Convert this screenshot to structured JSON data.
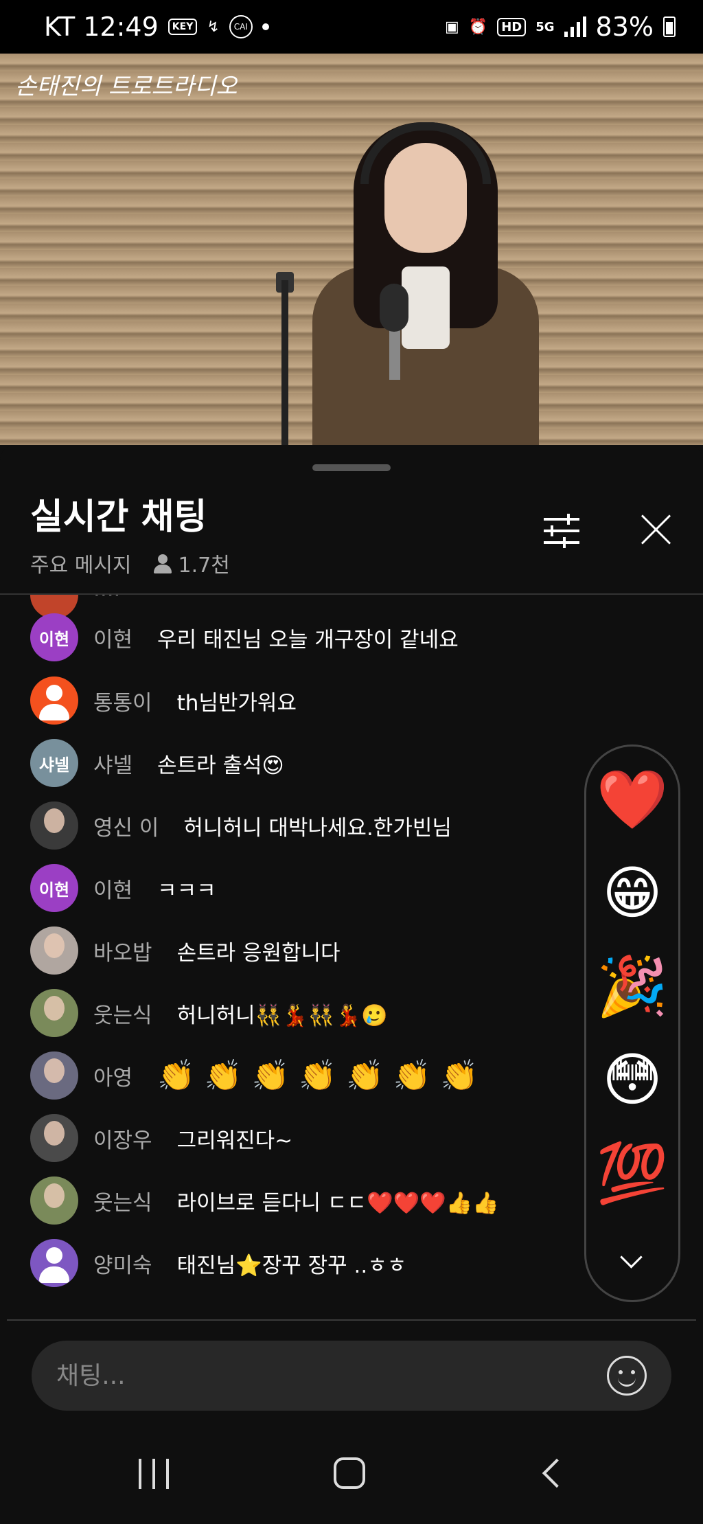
{
  "status_bar": {
    "carrier_time": "KT 12:49",
    "key_badge": "KEY",
    "cai_badge": "CAI",
    "hd_badge": "HD",
    "network": "5G",
    "battery": "83%"
  },
  "video": {
    "logo_text": "손태진의 트로트라디오"
  },
  "chat": {
    "title": "실시간 채팅",
    "mode": "주요 메시지",
    "viewer_count": "1.7천"
  },
  "messages": [
    {
      "author": "이현",
      "avatar_text": "이현",
      "avatar_color": "#9b3fc4",
      "text": "우리 태진님 오늘 개구장이 같네요"
    },
    {
      "author": "통통이",
      "avatar_text": "",
      "avatar_color": "#f4511e",
      "text": "th님반가워요"
    },
    {
      "author": "샤넬",
      "avatar_text": "샤넬",
      "avatar_color": "#78909c",
      "text": "손트라 출석😍"
    },
    {
      "author": "영신 이",
      "avatar_text": "",
      "avatar_color": "#3a3a3a",
      "text": "허니허니 대박나세요.한가빈님"
    },
    {
      "author": "이현",
      "avatar_text": "이현",
      "avatar_color": "#9b3fc4",
      "text": "ㅋㅋㅋ"
    },
    {
      "author": "바오밥",
      "avatar_text": "",
      "avatar_color": "#b0a6a0",
      "text": "손트라 응원합니다"
    },
    {
      "author": "웃는식",
      "avatar_text": "",
      "avatar_color": "#7a8a5a",
      "text": "허니허니👯‍♂️💃👯‍♂️💃🥲"
    },
    {
      "author": "아영",
      "avatar_text": "",
      "avatar_color": "#6a6a80",
      "text": "👏 👏 👏 👏 👏 👏 👏"
    },
    {
      "author": "이장우",
      "avatar_text": "",
      "avatar_color": "#4a4a4a",
      "text": "그리워진다~"
    },
    {
      "author": "웃는식",
      "avatar_text": "",
      "avatar_color": "#7a8a5a",
      "text": "라이브로 듣다니 ㄷㄷ❤️❤️❤️👍👍"
    },
    {
      "author": "양미숙",
      "avatar_text": "",
      "avatar_color": "#7e57c2",
      "text": "태진님⭐장꾸 장꾸 ..ㅎㅎ"
    }
  ],
  "reactions": [
    "❤️",
    "😁",
    "🎉",
    "😳",
    "💯"
  ],
  "input": {
    "placeholder": "채팅..."
  }
}
